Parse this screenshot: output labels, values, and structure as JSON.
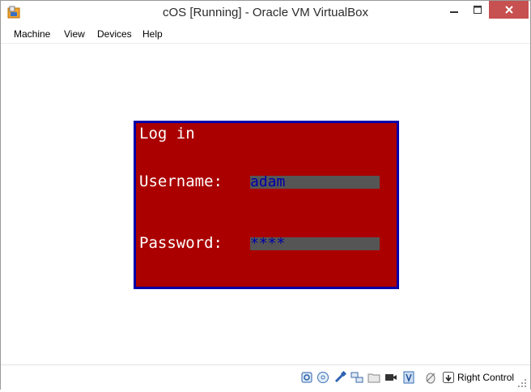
{
  "window": {
    "title": "cOS [Running] - Oracle VM VirtualBox",
    "close_color": "#c75050"
  },
  "menubar": {
    "items": [
      "Machine",
      "View",
      "Devices",
      "Help"
    ]
  },
  "guest": {
    "dialog_title": "Log in",
    "username_label": "Username:",
    "username_value": "adam",
    "password_label": "Password:",
    "password_value": "****",
    "colors": {
      "background": "#aa0000",
      "border": "#0000aa",
      "label_text": "#ffffff",
      "field_background": "#555555",
      "field_text": "#0000aa"
    }
  },
  "statusbar": {
    "icons": [
      "hard-disk-icon",
      "optical-drive-icon",
      "usb-icon",
      "network-icon",
      "shared-folders-icon",
      "video-capture-icon",
      "virtualization-icon",
      "mouse-integration-icon",
      "host-key-icon"
    ],
    "host_key_label": "Right Control"
  }
}
